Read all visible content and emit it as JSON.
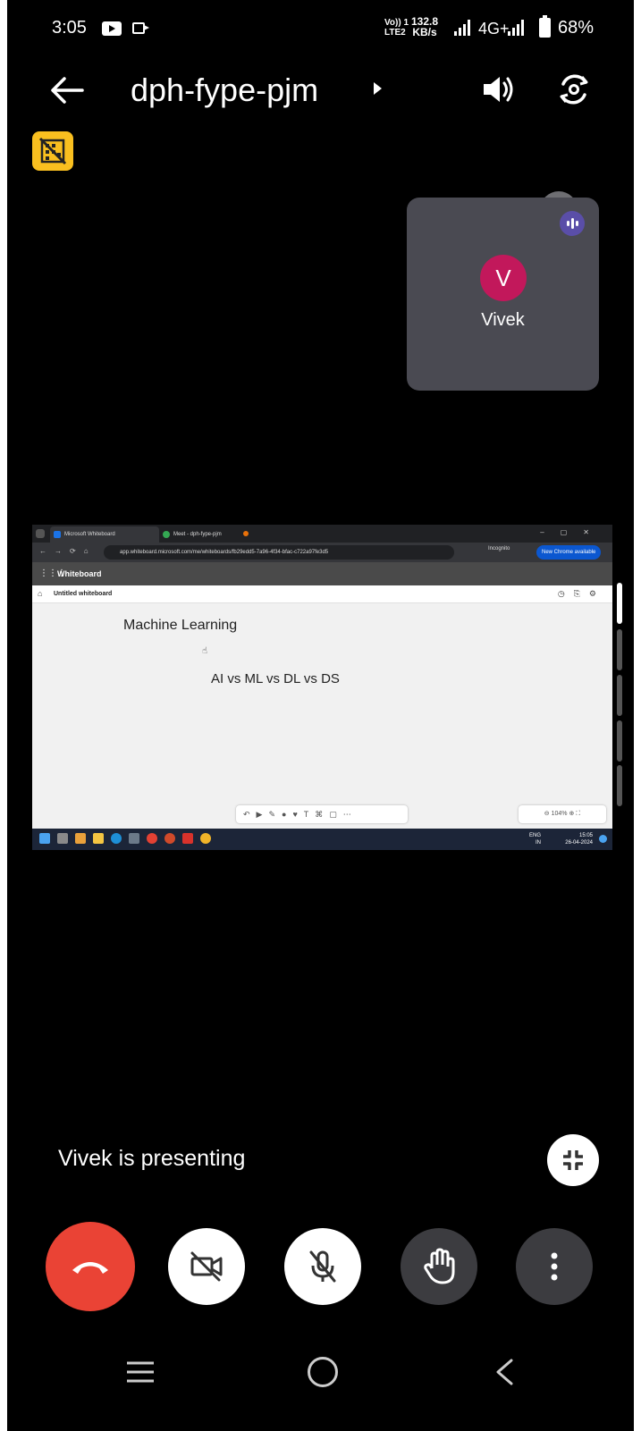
{
  "status_bar": {
    "time": "3:05",
    "volte_top": "Vo)) 1",
    "volte_bottom": "LTE2",
    "speed_value": "132.8",
    "speed_unit": "KB/s",
    "network": "4G+",
    "battery": "68%"
  },
  "header": {
    "meeting_code": "dph-fype-pjm"
  },
  "participant_tile": {
    "avatar_initial": "V",
    "name": "Vivek",
    "avatar_color": "#c2185b"
  },
  "shared_screen": {
    "tabs": [
      "Microsoft Whiteboard",
      "Meet - dph-fype-pjm"
    ],
    "url": "app.whiteboard.microsoft.com/me/whiteboards/fb29edd5-7a96-4f34-bfac-c722a97fe3d5",
    "incognito_label": "Incognito",
    "new_chrome_label": "New Chrome available",
    "app_name": "Whiteboard",
    "doc_name": "Untitled whiteboard",
    "canvas_text_1": "Machine Learning",
    "canvas_text_2": "AI vs ML vs DL vs DS",
    "zoom_level": "104%",
    "tray_lang_top": "ENG",
    "tray_lang_bottom": "IN",
    "clock_time": "15:05",
    "clock_date": "26-04-2024"
  },
  "presenting_label": "Vivek is presenting",
  "colors": {
    "end_call": "#ea4335",
    "badge": "#f9bf1f",
    "voice_indicator": "#5a4ea8"
  }
}
